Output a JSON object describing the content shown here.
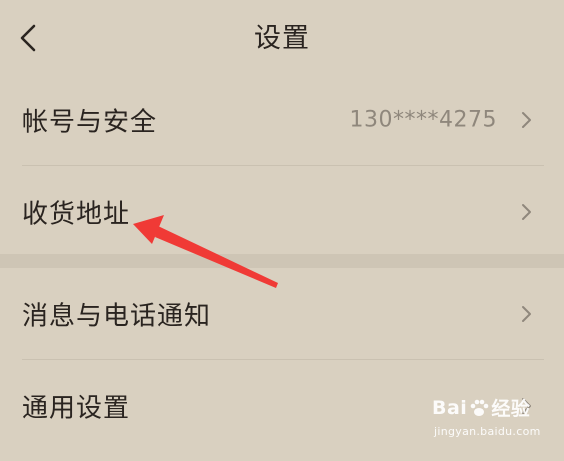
{
  "header": {
    "title": "设置",
    "back_icon": "chevron-left-icon"
  },
  "settings": {
    "group1": [
      {
        "id": "account-security",
        "label": "帐号与安全",
        "value": "130****4275",
        "icon": "chevron-right-icon"
      },
      {
        "id": "shipping-address",
        "label": "收货地址",
        "value": "",
        "icon": "chevron-right-icon"
      }
    ],
    "group2": [
      {
        "id": "message-call-notification",
        "label": "消息与电话通知",
        "icon": "chevron-right-icon"
      },
      {
        "id": "general-settings",
        "label": "通用设置",
        "icon": "chevron-right-icon"
      }
    ]
  },
  "watermark": {
    "brand_left": "Bai",
    "brand_right": "经验",
    "url": "jingyan.baidu.com"
  },
  "colors": {
    "background": "#d9d0c0",
    "section_gap": "#cec5b5",
    "divider": "#cac1b1",
    "text_primary": "#2a2420",
    "text_secondary": "#8f877c",
    "annotation_arrow": "#f03a36"
  }
}
